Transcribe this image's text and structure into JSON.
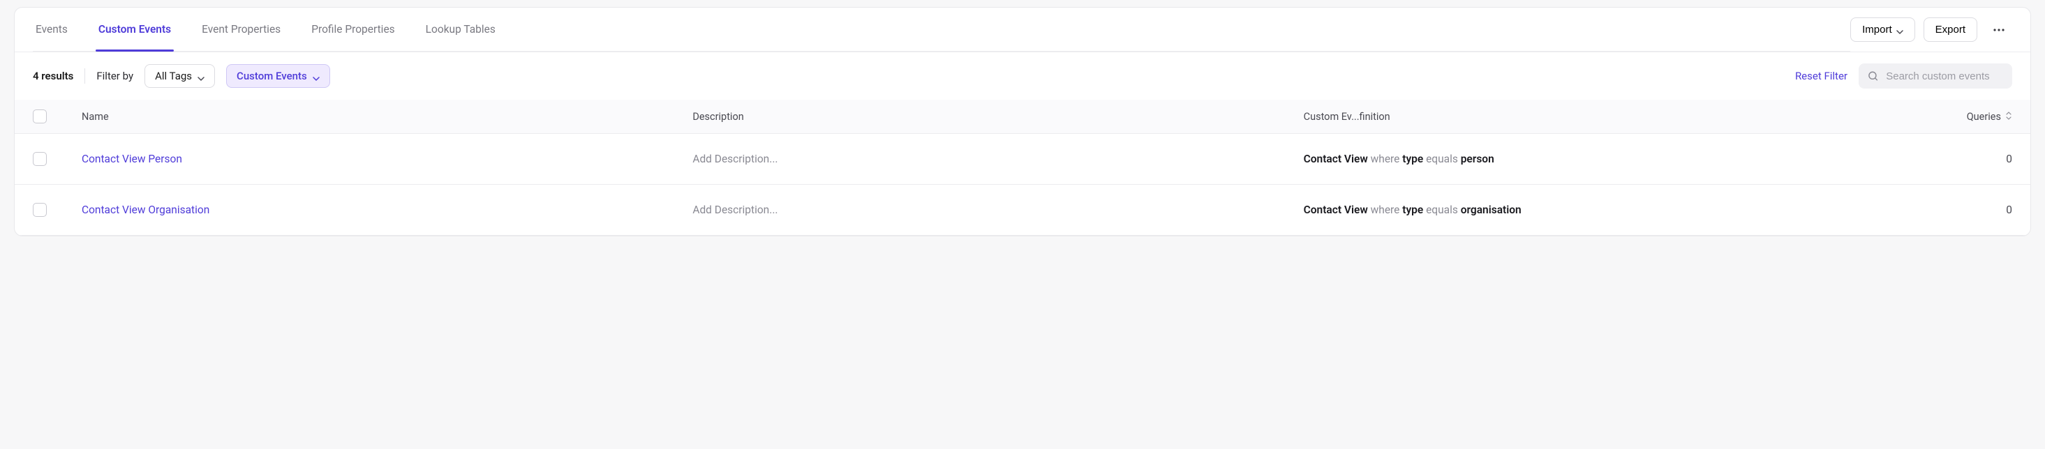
{
  "tabs": [
    {
      "label": "Events",
      "active": false
    },
    {
      "label": "Custom Events",
      "active": true
    },
    {
      "label": "Event Properties",
      "active": false
    },
    {
      "label": "Profile Properties",
      "active": false
    },
    {
      "label": "Lookup Tables",
      "active": false
    }
  ],
  "actions": {
    "import": "Import",
    "export": "Export"
  },
  "filters": {
    "results_text": "4 results",
    "filter_by_label": "Filter by",
    "all_tags_label": "All Tags",
    "custom_events_chip": "Custom Events",
    "reset_label": "Reset Filter",
    "search_placeholder": "Search custom events"
  },
  "columns": {
    "name": "Name",
    "description": "Description",
    "definition": "Custom Ev...finition",
    "queries": "Queries"
  },
  "rows": [
    {
      "name": "Contact View Person",
      "description_placeholder": "Add Description...",
      "def_event": "Contact View",
      "def_where": "where",
      "def_prop": "type",
      "def_equals": "equals",
      "def_value": "person",
      "queries": "0"
    },
    {
      "name": "Contact View Organisation",
      "description_placeholder": "Add Description...",
      "def_event": "Contact View",
      "def_where": "where",
      "def_prop": "type",
      "def_equals": "equals",
      "def_value": "organisation",
      "queries": "0"
    }
  ]
}
